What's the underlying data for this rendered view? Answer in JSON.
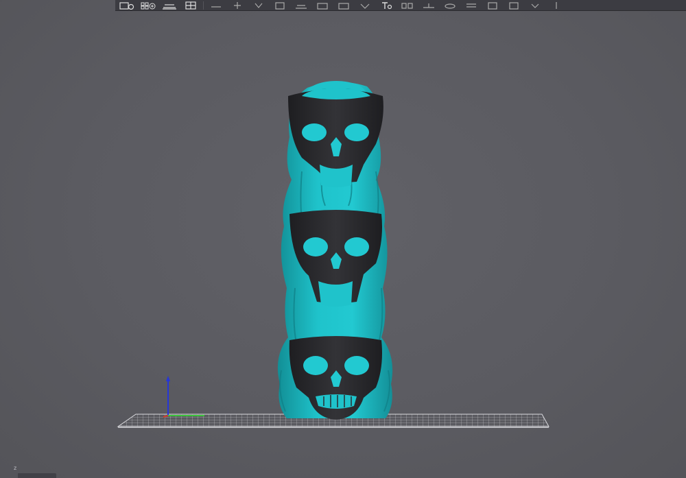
{
  "app": {
    "toolbar": {
      "items": [
        {
          "icon": "add-object-icon"
        },
        {
          "icon": "arrange-grid-icon"
        },
        {
          "icon": "bed-plate-icon"
        },
        {
          "icon": "split-view-icon"
        },
        {
          "icon": "separator"
        },
        {
          "icon": "move-icon"
        },
        {
          "icon": "rotate-icon"
        },
        {
          "icon": "scale-icon"
        },
        {
          "icon": "cut-icon"
        },
        {
          "icon": "place-on-face-icon"
        },
        {
          "icon": "support-paint-icon"
        },
        {
          "icon": "seam-paint-icon"
        },
        {
          "icon": "color-paint-icon"
        },
        {
          "icon": "text-tool-icon"
        },
        {
          "icon": "measure-icon"
        },
        {
          "icon": "assembly-icon"
        },
        {
          "icon": "layers-icon"
        },
        {
          "icon": "slice-icon"
        },
        {
          "icon": "preview-icon"
        },
        {
          "icon": "undo-icon"
        },
        {
          "icon": "redo-icon"
        },
        {
          "icon": "more-icon"
        }
      ]
    },
    "scene": {
      "axis_label": "z",
      "colors": {
        "background": "#5a5a60",
        "filament_primary": "#1fbcc4",
        "filament_secondary": "#2a2a2e",
        "bed_grid": "#d6d6da",
        "axis_x": "#d43a2a",
        "axis_y": "#3cc43c",
        "axis_z": "#2a3ad4"
      }
    }
  }
}
